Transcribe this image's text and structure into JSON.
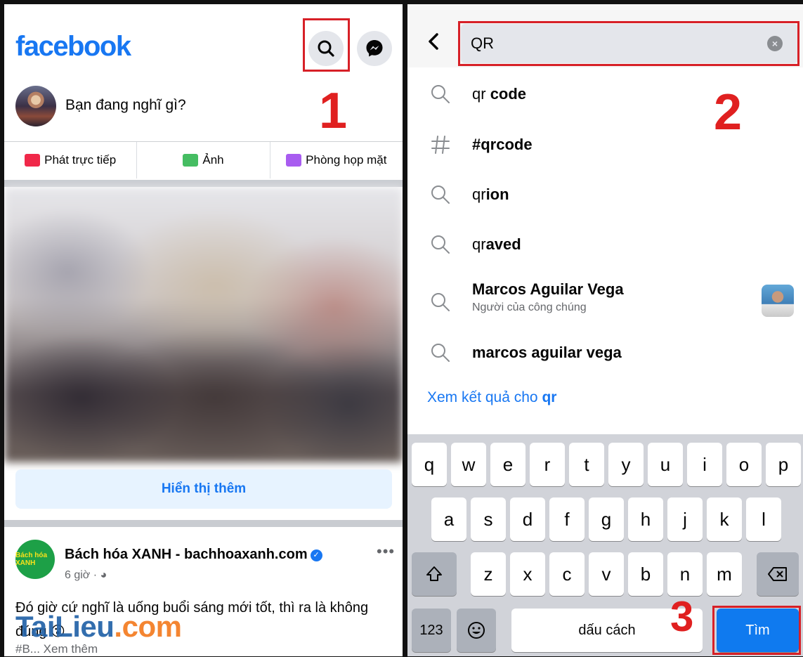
{
  "left": {
    "logo": "facebook",
    "step_label": "1",
    "composer_prompt": "Bạn đang nghĩ gì?",
    "actions": [
      {
        "label": "Phát trực tiếp",
        "icon": "live-video-icon",
        "color": "#f02849"
      },
      {
        "label": "Ảnh",
        "icon": "photo-icon",
        "color": "#45bd62"
      },
      {
        "label": "Phòng họp mặt",
        "icon": "room-icon",
        "color": "#a85cf0"
      }
    ],
    "show_more": "Hiển thị thêm",
    "post": {
      "page_name": "Bách hóa XANH - bachhoaxanh.com",
      "avatar_text": "Bách hóa XANH",
      "time": "6 giờ ·",
      "text": "Đó giờ cứ nghĩ là uống buổi sáng mới tốt, thì ra là không đúng 😮",
      "see_more": "#B... Xem thêm"
    },
    "watermark": {
      "part1": "Tai",
      "part2": "Lieu",
      "part3": ".com"
    }
  },
  "right": {
    "search_value": "QR",
    "step2_label": "2",
    "step3_label": "3",
    "suggestions": [
      {
        "prefix": "qr ",
        "bold": "code",
        "icon": "search-icon"
      },
      {
        "prefix": "",
        "bold": "#qrcode",
        "icon": "hashtag-icon"
      },
      {
        "prefix": "qr",
        "bold": "ion",
        "icon": "search-icon"
      },
      {
        "prefix": "qr",
        "bold": "aved",
        "icon": "search-icon"
      },
      {
        "prefix": "",
        "bold": "Marcos Aguilar Vega",
        "sub": "Người của công chúng",
        "icon": "search-icon"
      },
      {
        "prefix": "",
        "bold": "marcos aguilar vega",
        "icon": "search-icon"
      }
    ],
    "see_results_prefix": "Xem kết quả cho ",
    "see_results_query": "qr",
    "keyboard": {
      "row1": [
        "q",
        "w",
        "e",
        "r",
        "t",
        "y",
        "u",
        "i",
        "o",
        "p"
      ],
      "row2": [
        "a",
        "s",
        "d",
        "f",
        "g",
        "h",
        "j",
        "k",
        "l"
      ],
      "row3": [
        "z",
        "x",
        "c",
        "v",
        "b",
        "n",
        "m"
      ],
      "numbers_key": "123",
      "space_key": "dấu cách",
      "search_key": "Tìm"
    }
  },
  "colors": {
    "brand": "#1877f2",
    "annotation_red": "#e02020",
    "keyboard_bg": "#d1d3d9"
  }
}
